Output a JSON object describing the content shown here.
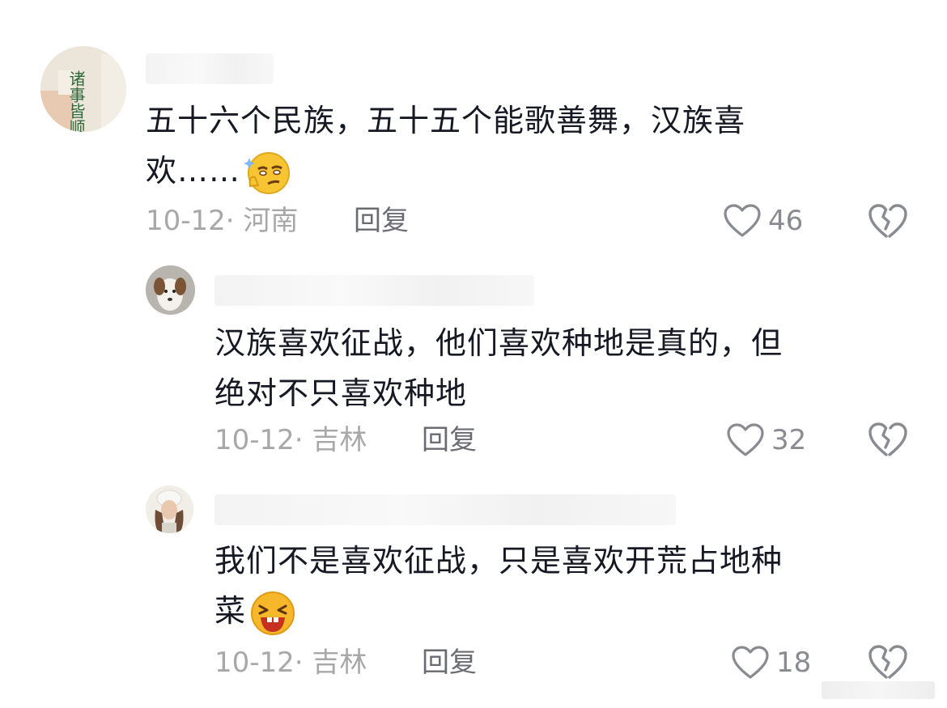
{
  "comments": [
    {
      "text": "五十六个民族，五十五个能歌善舞，汉族喜\n欢……",
      "emoji": "smirk-emoji",
      "date": "10-12",
      "location": "河南",
      "reply_label": "回复",
      "likes": "46"
    },
    {
      "text": "汉族喜欢征战，他们喜欢种地是真的，但\n绝对不只喜欢种地",
      "date": "10-12",
      "location": "吉林",
      "reply_label": "回复",
      "likes": "32"
    },
    {
      "text": "我们不是喜欢征战，只是喜欢开荒占地种\n菜",
      "emoji": "laughing-emoji",
      "date": "10-12",
      "location": "吉林",
      "reply_label": "回复",
      "likes": "18"
    }
  ],
  "meta_separator": "· ",
  "avatars": {
    "first": "诸事皆顺"
  }
}
